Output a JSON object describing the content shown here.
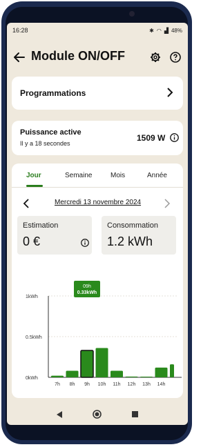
{
  "status": {
    "time": "16:28",
    "battery": "48%"
  },
  "appbar": {
    "title": "Module ON/OFF"
  },
  "programmations": {
    "label": "Programmations"
  },
  "power": {
    "label": "Puissance active",
    "subtitle": "Il y a 18 secondes",
    "value": "1509 W"
  },
  "tabs": [
    "Jour",
    "Semaine",
    "Mois",
    "Année"
  ],
  "date": {
    "label": "Mercredi 13 novembre 2024"
  },
  "estimation": {
    "title": "Estimation",
    "value": "0 €"
  },
  "consommation": {
    "title": "Consommation",
    "value": "1.2 kWh"
  },
  "colors": {
    "accent": "#2a7d1d",
    "background": "#efe9dd"
  },
  "chart_data": {
    "type": "bar",
    "categories": [
      "7h",
      "8h",
      "9h",
      "10h",
      "11h",
      "12h",
      "13h",
      "14h",
      "15h"
    ],
    "values": [
      0.02,
      0.08,
      0.33,
      0.36,
      0.08,
      0.01,
      0.005,
      0.12,
      0.16
    ],
    "ylim": [
      0,
      1
    ],
    "yticks": [
      "1kWh",
      "0.5kWh",
      "0kWh"
    ],
    "selected": {
      "category": "9h",
      "label": "09h",
      "value_label": "0.33kWh"
    }
  }
}
